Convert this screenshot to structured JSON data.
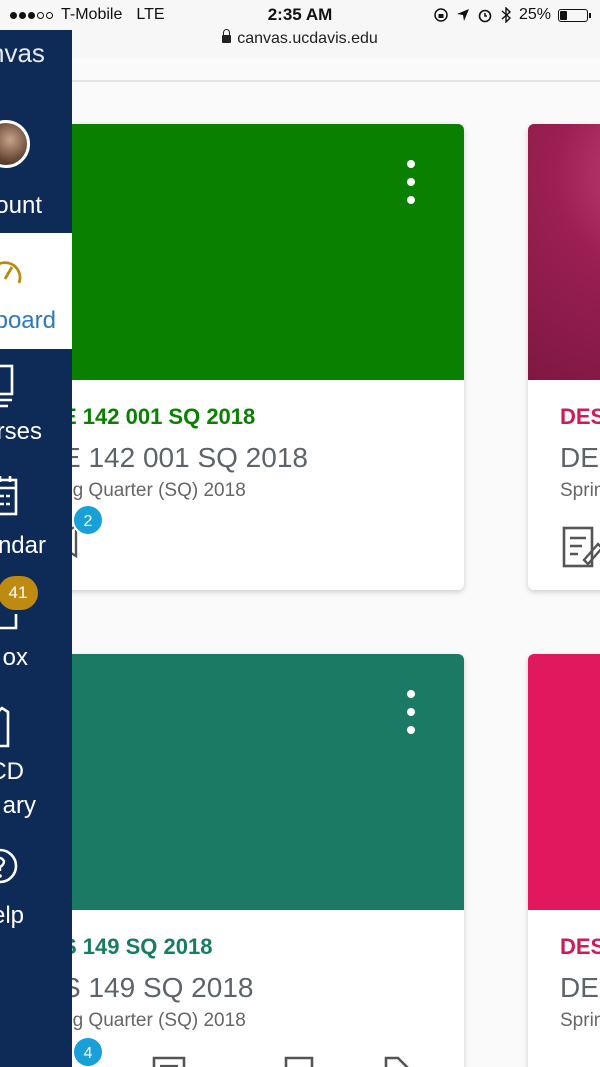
{
  "status_bar": {
    "carrier": "T-Mobile",
    "network": "LTE",
    "time": "2:35 AM",
    "battery": "25%",
    "battery_level": 0.25
  },
  "browser": {
    "url": "canvas.ucdavis.edu"
  },
  "nav": {
    "brand": "nvas",
    "items": [
      {
        "label": "ount",
        "icon": "user-avatar"
      },
      {
        "label": "board",
        "icon": "dashboard-icon",
        "active": true
      },
      {
        "label": "rses",
        "icon": "courses-icon"
      },
      {
        "label": "ndar",
        "icon": "calendar-icon"
      },
      {
        "label": "ox",
        "icon": "inbox-icon",
        "badge": "41"
      },
      {
        "label": "CD",
        "label2": "ary",
        "icon": "library-icon"
      },
      {
        "label": "elp",
        "icon": "help-icon"
      }
    ]
  },
  "cards": [
    {
      "code": "E 142 001 SQ 2018",
      "name": "E 142 001 SQ 2018",
      "term": "ng Quarter (SQ) 2018",
      "badge": "2",
      "color": "#0a8000"
    },
    {
      "code": "DES",
      "name": "DES",
      "term": "Sprin",
      "color": "#9b1f52"
    },
    {
      "code": "S 149 SQ 2018",
      "name": "S 149 SQ 2018",
      "term": "ng Quarter (SQ) 2018",
      "badge": "4",
      "color": "#1a7a64"
    },
    {
      "code": "DES",
      "name": "DES",
      "term": "Sprin",
      "color": "#e0195e"
    }
  ]
}
